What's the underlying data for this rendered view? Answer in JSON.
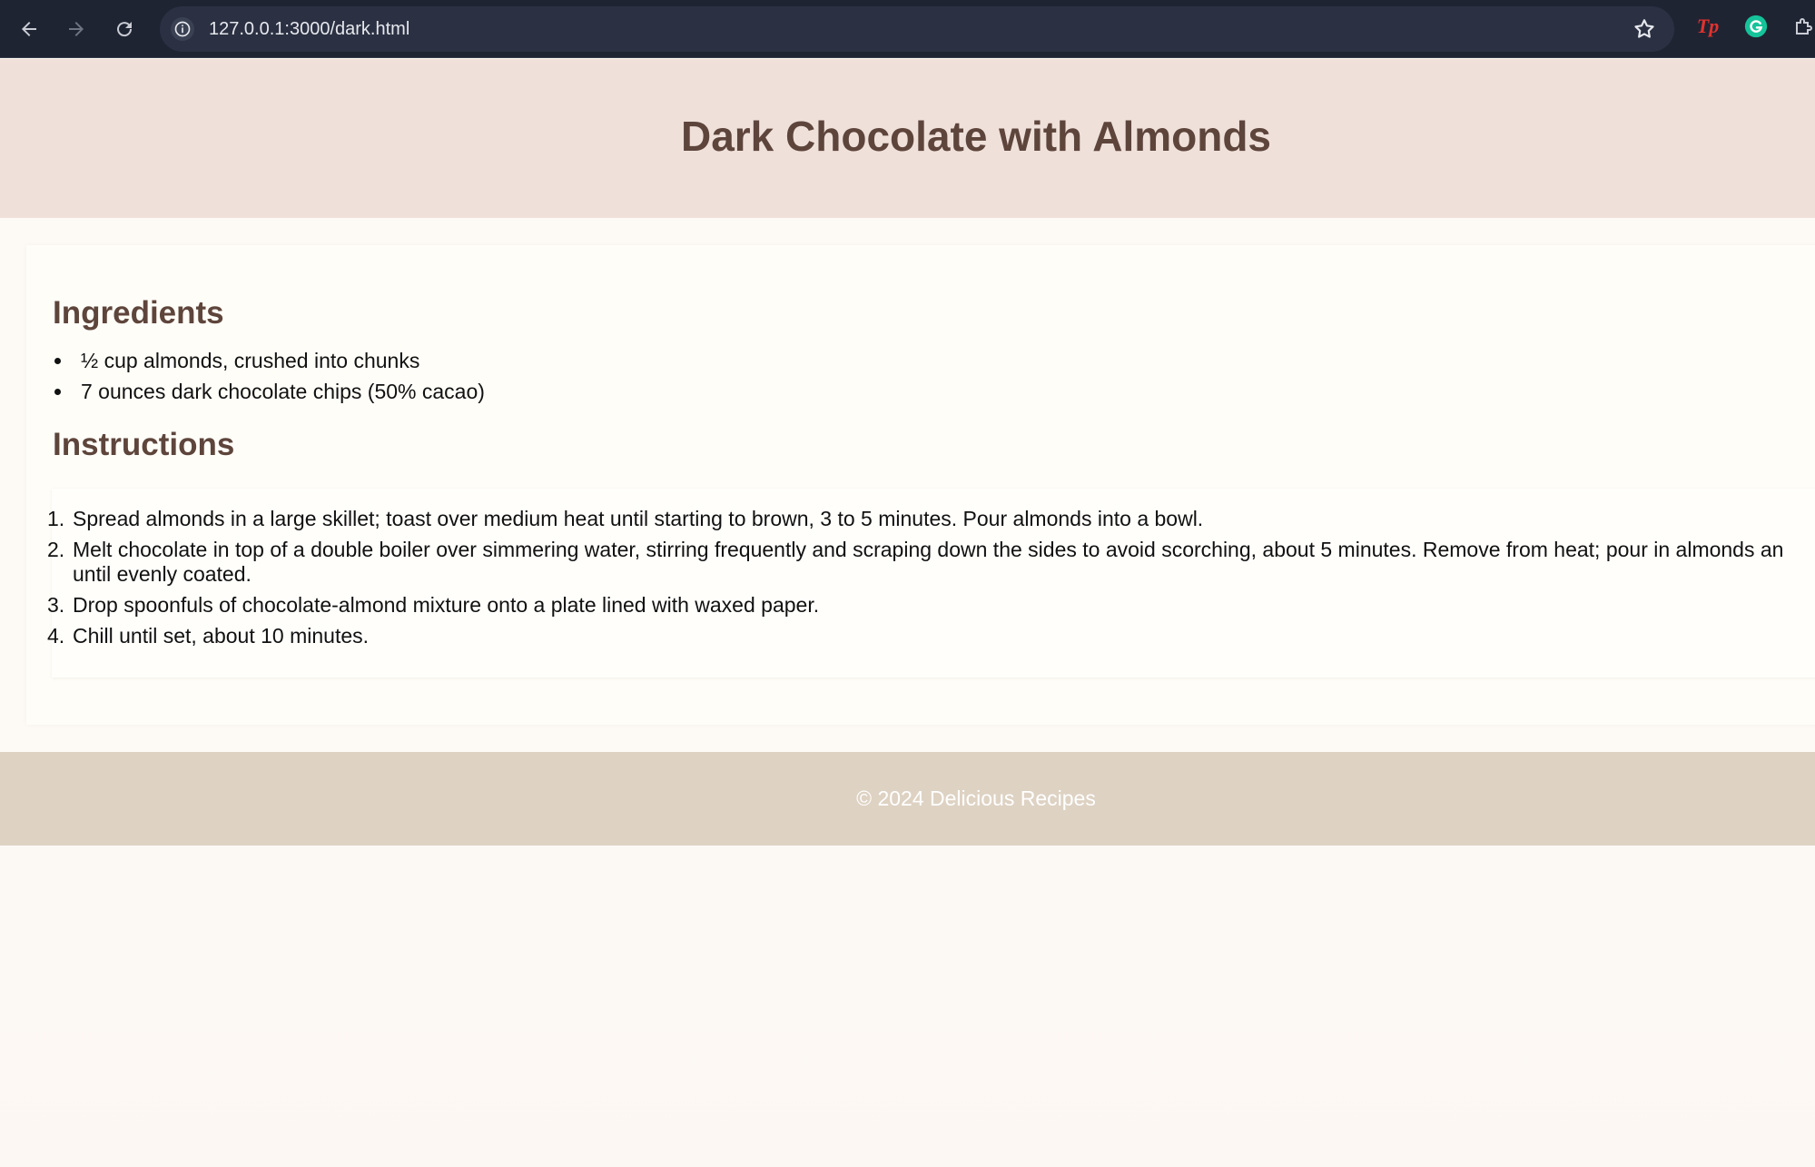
{
  "browser": {
    "url": "127.0.0.1:3000/dark.html",
    "icons": {
      "back": "back-arrow-icon",
      "forward": "forward-arrow-icon",
      "reload": "reload-icon",
      "site_info": "info-icon",
      "bookmark": "star-icon",
      "ext1": "tp-extension-icon",
      "ext2": "grammarly-icon",
      "ext3": "puzzle-extensions-icon"
    },
    "ext_tp_label": "Tp"
  },
  "header": {
    "title": "Dark Chocolate with Almonds"
  },
  "ingredients": {
    "heading": "Ingredients",
    "items": [
      "½ cup almonds, crushed into chunks",
      "7 ounces dark chocolate chips (50% cacao)"
    ]
  },
  "instructions": {
    "heading": "Instructions",
    "steps": [
      {
        "num": "1.",
        "text": "Spread almonds in a large skillet; toast over medium heat until starting to brown, 3 to 5 minutes. Pour almonds into a bowl."
      },
      {
        "num": "2.",
        "text": "Melt chocolate in top of a double boiler over simmering water, stirring frequently and scraping down the sides to avoid scorching, about 5 minutes. Remove from heat; pour in almonds an",
        "text2": "until evenly coated."
      },
      {
        "num": "3.",
        "text": "Drop spoonfuls of chocolate-almond mixture onto a plate lined with waxed paper."
      },
      {
        "num": "4.",
        "text": "Chill until set, about 10 minutes."
      }
    ]
  },
  "footer": {
    "text": "© 2024 Delicious Recipes"
  },
  "colors": {
    "header_bg": "#efe1da",
    "title_color": "#5e453c",
    "footer_bg": "#ded2c3",
    "chrome_bg": "#1f2433"
  }
}
